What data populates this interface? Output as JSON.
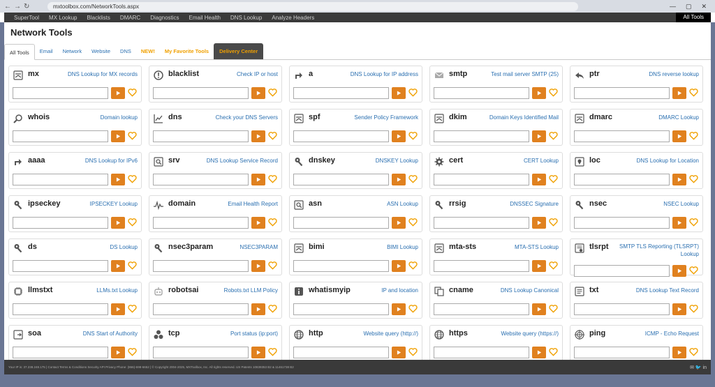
{
  "browser": {
    "back": "←",
    "forward": "→",
    "reload": "↻",
    "url": "mxtoolbox.com/NetworkTools.aspx",
    "window_controls": [
      "—",
      "▢",
      "✕"
    ]
  },
  "topnav": {
    "items": [
      "SuperTool",
      "MX Lookup",
      "Blacklists",
      "DMARC",
      "Diagnostics",
      "Email Health",
      "DNS Lookup",
      "Analyze Headers"
    ],
    "all_tools": "All Tools"
  },
  "page": {
    "title": "Network Tools"
  },
  "tabs": [
    {
      "label": "All Tools",
      "style": "active"
    },
    {
      "label": "Email",
      "style": "normal"
    },
    {
      "label": "Network",
      "style": "normal"
    },
    {
      "label": "Website",
      "style": "normal"
    },
    {
      "label": "DNS",
      "style": "normal"
    },
    {
      "label": "NEW!",
      "style": "orange"
    },
    {
      "label": "My Favorite Tools",
      "style": "orange"
    },
    {
      "label": "Delivery Center",
      "style": "dark"
    }
  ],
  "colors": {
    "accent": "#e0811f",
    "link": "#2a6fb0",
    "favorite": "#f0a000",
    "nav": "#3a3a3a"
  },
  "tools": [
    {
      "name": "mx",
      "desc": "DNS Lookup for MX records",
      "icon": "mx-icon"
    },
    {
      "name": "blacklist",
      "desc": "Check IP or host",
      "icon": "blacklist-icon"
    },
    {
      "name": "a",
      "desc": "DNS Lookup for IP address",
      "icon": "a-record-icon"
    },
    {
      "name": "smtp",
      "desc": "Test mail server SMTP (25)",
      "icon": "envelope-icon"
    },
    {
      "name": "ptr",
      "desc": "DNS reverse lookup",
      "icon": "reply-icon"
    },
    {
      "name": "whois",
      "desc": "Domain lookup",
      "icon": "magnifier-icon"
    },
    {
      "name": "dns",
      "desc": "Check your DNS Servers",
      "icon": "chart-icon"
    },
    {
      "name": "spf",
      "desc": "Sender Policy Framework",
      "icon": "spf-icon"
    },
    {
      "name": "dkim",
      "desc": "Domain Keys Identified Mail",
      "icon": "dkim-icon"
    },
    {
      "name": "dmarc",
      "desc": "DMARC Lookup",
      "icon": "dmarc-icon"
    },
    {
      "name": "aaaa",
      "desc": "DNS Lookup for IPv6",
      "icon": "aaaa-icon"
    },
    {
      "name": "srv",
      "desc": "DNS Lookup Service Record",
      "icon": "srv-icon"
    },
    {
      "name": "dnskey",
      "desc": "DNSKEY Lookup",
      "icon": "key-icon"
    },
    {
      "name": "cert",
      "desc": "CERT Lookup",
      "icon": "gear-icon"
    },
    {
      "name": "loc",
      "desc": "DNS Lookup for Location",
      "icon": "location-icon"
    },
    {
      "name": "ipseckey",
      "desc": "IPSECKEY Lookup",
      "icon": "key-icon"
    },
    {
      "name": "domain",
      "desc": "Email Health Report",
      "icon": "pulse-icon"
    },
    {
      "name": "asn",
      "desc": "ASN Lookup",
      "icon": "asn-icon"
    },
    {
      "name": "rrsig",
      "desc": "DNSSEC Signature",
      "icon": "key-icon"
    },
    {
      "name": "nsec",
      "desc": "NSEC Lookup",
      "icon": "key-icon"
    },
    {
      "name": "ds",
      "desc": "DS Lookup",
      "icon": "key-icon"
    },
    {
      "name": "nsec3param",
      "desc": "NSEC3PARAM",
      "icon": "key-icon"
    },
    {
      "name": "bimi",
      "desc": "BIMI Lookup",
      "icon": "bimi-icon"
    },
    {
      "name": "mta-sts",
      "desc": "MTA-STS Lookup",
      "icon": "mta-sts-icon"
    },
    {
      "name": "tlsrpt",
      "desc": "SMTP TLS Reporting (TLSRPT) Lookup",
      "icon": "report-icon",
      "tall": true
    },
    {
      "name": "llmstxt",
      "desc": "LLMs.txt Lookup",
      "icon": "chip-icon"
    },
    {
      "name": "robotsai",
      "desc": "Robots.txt LLM Policy",
      "icon": "robot-icon"
    },
    {
      "name": "whatismyip",
      "desc": "IP and location",
      "icon": "info-icon"
    },
    {
      "name": "cname",
      "desc": "DNS Lookup Canonical",
      "icon": "copy-icon"
    },
    {
      "name": "txt",
      "desc": "DNS Lookup Text Record",
      "icon": "text-icon"
    },
    {
      "name": "soa",
      "desc": "DNS Start of Authority",
      "icon": "soa-icon"
    },
    {
      "name": "tcp",
      "desc": "Port status (ip:port)",
      "icon": "tcp-icon"
    },
    {
      "name": "http",
      "desc": "Website query (http://)",
      "icon": "globe-icon"
    },
    {
      "name": "https",
      "desc": "Website query (https://)",
      "icon": "globe-icon"
    },
    {
      "name": "ping",
      "desc": "ICMP - Echo Request",
      "icon": "ping-icon"
    }
  ],
  "footer": {
    "text": "Your IP is: 37.238.248.175 | Contact Terms & Conditions Security API Privacy Phone: (866)-698-6652 | © Copyright 2004-2025, MXToolbox, Inc. All rights reserved. US Patents 10839353 B2 & 11461738 B2",
    "social": "✉ 🐦 in"
  }
}
